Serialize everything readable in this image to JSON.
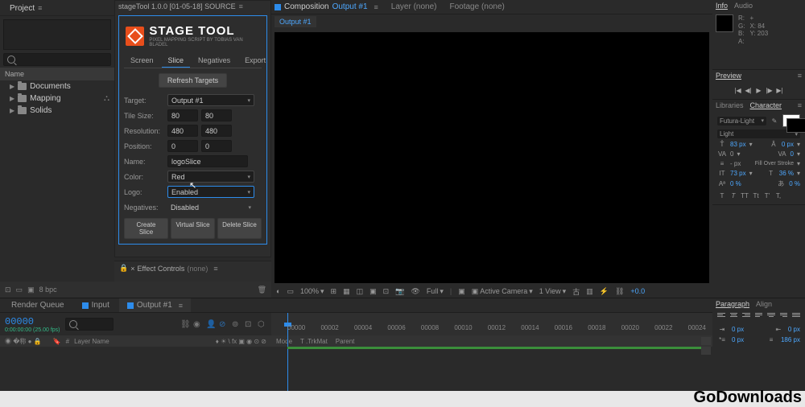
{
  "project": {
    "tab": "Project",
    "name_col": "Name",
    "items": [
      "Documents",
      "Mapping",
      "Solids"
    ]
  },
  "script": {
    "title_tab": "stageTool 1.0.0 [01-05-18] SOURCE",
    "brand": "STAGE TOOL",
    "brand_sub": "PIXEL MAPPING SCRIPT BY TOBIAS VAN BLADEL",
    "tabs": [
      "Screen",
      "Slice",
      "Negatives",
      "Export"
    ],
    "active_tab": 1,
    "refresh": "Refresh Targets",
    "rows": {
      "target_label": "Target:",
      "target_val": "Output #1",
      "tile_label": "Tile Size:",
      "tile_w": "80",
      "tile_h": "80",
      "res_label": "Resolution:",
      "res_w": "480",
      "res_h": "480",
      "pos_label": "Position:",
      "pos_x": "0",
      "pos_y": "0",
      "name_label": "Name:",
      "name_val": "logoSlice",
      "color_label": "Color:",
      "color_val": "Red",
      "logo_label": "Logo:",
      "logo_val": "Enabled",
      "neg_label": "Negatives:",
      "neg_val": "Disabled"
    },
    "buttons": [
      "Create Slice",
      "Virtual Slice",
      "Delete Slice"
    ]
  },
  "fx": {
    "label": "Effect Controls",
    "none": "(none)"
  },
  "comp": {
    "tabs": {
      "comp": "Composition",
      "comp_name": "Output #1",
      "layer": "Layer (none)",
      "footage": "Footage (none)"
    },
    "output_tab": "Output #1",
    "footer": {
      "zoom": "100%",
      "res": "Full",
      "camera": "Active Camera",
      "view": "1 View",
      "plus": "+0.0"
    }
  },
  "info": {
    "tabs": [
      "Info",
      "Audio"
    ],
    "r": "R:",
    "g": "G:",
    "b": "B:",
    "a": "A:",
    "x": "X: 84",
    "y": "Y: 203"
  },
  "preview": {
    "tab": "Preview"
  },
  "libraries": {
    "tabs": [
      "Libraries",
      "Character"
    ]
  },
  "char": {
    "font": "Futura-Light",
    "style": "Light",
    "size": "83 px",
    "leading": "0 px",
    "kern": "0",
    "track": "0",
    "fill_stroke": "Fill Over Stroke",
    "vscale": "73 px",
    "hscale": "36 %",
    "baseline": "0 %",
    "tsume": "0 %",
    "btns": [
      "T",
      "T",
      "TT",
      "Tt",
      "T'",
      "T,"
    ]
  },
  "proj_footer": {
    "bpc": "8 bpc"
  },
  "timeline": {
    "tabs": [
      "Render Queue",
      "Input",
      "Output #1"
    ],
    "active_tab": 2,
    "timecode": "00000",
    "timecode_sub": "0:00:00:00 (25.00 fps)",
    "cols": {
      "num": "#",
      "layer": "Layer Name",
      "switches": "♦ ☀ \\ fx ▣ ◉ ⊙ ⊘",
      "mode": "Mode",
      "trkmat": "T .TrkMat",
      "parent": "Parent"
    },
    "ticks": [
      "00000",
      "00002",
      "00004",
      "00006",
      "00008",
      "00010",
      "00012",
      "00014",
      "00016",
      "00018",
      "00020",
      "00022",
      "00024"
    ]
  },
  "para": {
    "tabs": [
      "Paragraph",
      "Align"
    ],
    "v1": "0 px",
    "v2": "0 px",
    "v3": "0 px",
    "v4": "186 px"
  },
  "watermark": "GoDownloads"
}
